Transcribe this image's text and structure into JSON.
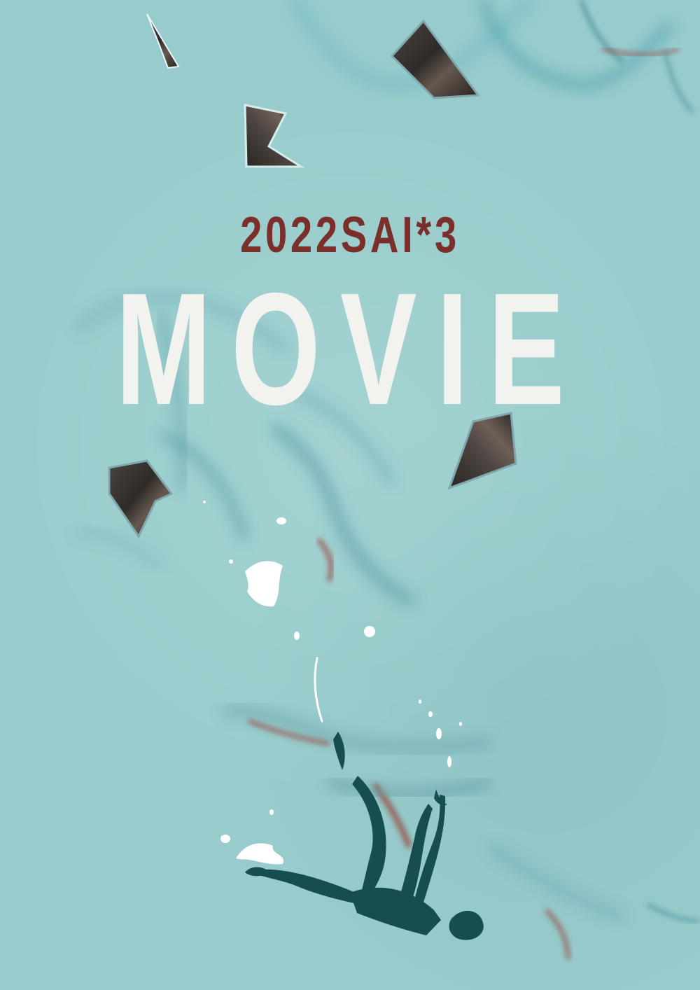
{
  "poster": {
    "subtitle": "2022SAI*3",
    "title": "MOVIE"
  },
  "colors": {
    "background": "#98cccc",
    "subtitle_text": "#7a2f2a",
    "title_text": "#f2f2ef",
    "fragment_dark": "#332f2b",
    "figure_dark": "#164d4f",
    "splash_white": "#ffffff",
    "vein_teal": "#2f7f8d",
    "vein_red": "#9a4e45"
  }
}
